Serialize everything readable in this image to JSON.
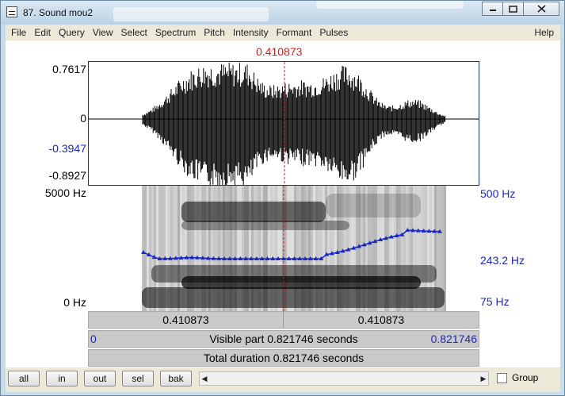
{
  "window": {
    "title": "87. Sound mou2",
    "minimize_icon": "minimize-icon",
    "maximize_icon": "maximize-icon",
    "close_icon": "close-icon"
  },
  "menu": {
    "items": [
      "File",
      "Edit",
      "Query",
      "View",
      "Select",
      "Spectrum",
      "Pitch",
      "Intensity",
      "Formant",
      "Pulses"
    ],
    "help": "Help"
  },
  "cursor": {
    "time": "0.410873",
    "color": "#e01818"
  },
  "waveform": {
    "ymax": "0.7617",
    "zero": "0",
    "selected_value": "-0.3947",
    "ymin": "-0.8927",
    "color": "#000000"
  },
  "spectrogram": {
    "freq_max": "5000 Hz",
    "freq_min": "0 Hz",
    "pitch_max": "500 Hz",
    "pitch_cursor": "243.2 Hz",
    "pitch_min": "75 Hz",
    "pitch_color": "#1a26c8"
  },
  "bars": {
    "left_part": "0.410873",
    "right_part": "0.410873",
    "visible_start": "0",
    "visible_label": "Visible part 0.821746 seconds",
    "visible_end": "0.821746",
    "total_label": "Total duration 0.821746 seconds"
  },
  "bottom": {
    "buttons": [
      "all",
      "in",
      "out",
      "sel",
      "bak"
    ],
    "group_label": "Group",
    "group_checked": false
  }
}
